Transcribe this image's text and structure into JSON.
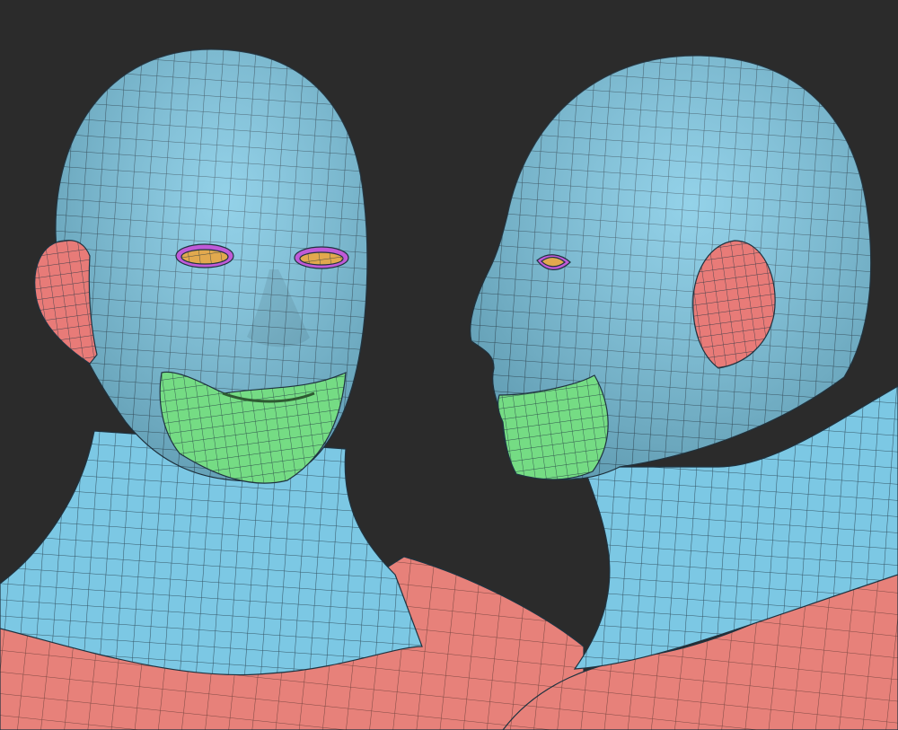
{
  "scene": {
    "background_color": "#2b2b2b",
    "polygroup_colors": {
      "head": "#7cc8e4",
      "ears": "#e87b78",
      "mouth_chin": "#75dc84",
      "eye_lids": "#e2a94e",
      "eye_rim": "#c05ad8",
      "shoulders": "#e7817a",
      "wire": "#1f3340"
    },
    "views": [
      {
        "name": "front-three-quarter"
      },
      {
        "name": "side-profile"
      }
    ]
  }
}
